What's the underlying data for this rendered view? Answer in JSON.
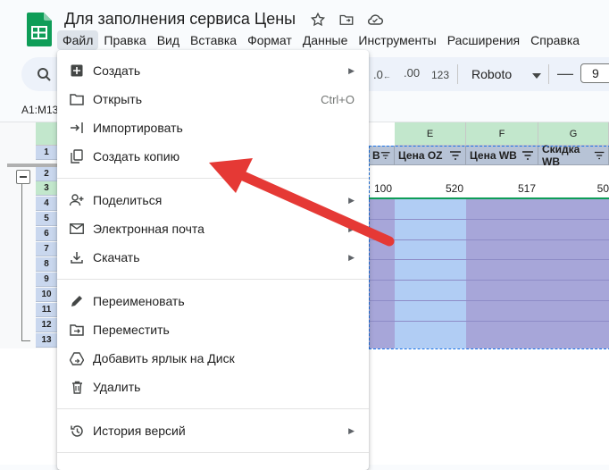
{
  "doc": {
    "title": "Для заполнения сервиса Цены"
  },
  "menubar": [
    "Файл",
    "Правка",
    "Вид",
    "Вставка",
    "Формат",
    "Данные",
    "Инструменты",
    "Расширения",
    "Справка"
  ],
  "toolbar": {
    "decimal_decrease": ".0",
    "decimal_increase": ".00",
    "more_formats": "123",
    "font": "Roboto",
    "font_size": "9"
  },
  "namebox": "A1:M13",
  "columns": [
    {
      "letter": "E",
      "header": "Цена OZ"
    },
    {
      "letter": "F",
      "header": "Цена WB"
    },
    {
      "letter": "G",
      "header": "Скидка WB"
    }
  ],
  "partial_header": "B",
  "row_values": {
    "d": "100",
    "e": "520",
    "f": "517",
    "g": "50"
  },
  "row_numbers": [
    "1",
    "2",
    "3",
    "4",
    "5",
    "6",
    "7",
    "8",
    "9",
    "10",
    "11",
    "12",
    "13"
  ],
  "file_menu": {
    "items": [
      {
        "label": "Создать",
        "icon": "plus-box-icon",
        "submenu": true
      },
      {
        "label": "Открыть",
        "icon": "folder-icon",
        "shortcut": "Ctrl+O"
      },
      {
        "label": "Импортировать",
        "icon": "import-icon"
      },
      {
        "label": "Создать копию",
        "icon": "copy-icon"
      },
      {
        "label": "Поделиться",
        "icon": "person-add-icon",
        "submenu": true
      },
      {
        "label": "Электронная почта",
        "icon": "mail-icon",
        "submenu": true
      },
      {
        "label": "Скачать",
        "icon": "download-icon",
        "submenu": true
      },
      {
        "label": "Переименовать",
        "icon": "pencil-icon"
      },
      {
        "label": "Переместить",
        "icon": "folder-move-icon"
      },
      {
        "label": "Добавить ярлык на Диск",
        "icon": "drive-shortcut-icon"
      },
      {
        "label": "Удалить",
        "icon": "trash-icon"
      },
      {
        "label": "История версий",
        "icon": "history-icon",
        "submenu": true
      }
    ]
  },
  "colors": {
    "accent_arrow": "#e53935",
    "menu_active": "#dde3ea",
    "purple_fill": "#a7a6d9",
    "blue_fill": "#b1cdf4"
  }
}
